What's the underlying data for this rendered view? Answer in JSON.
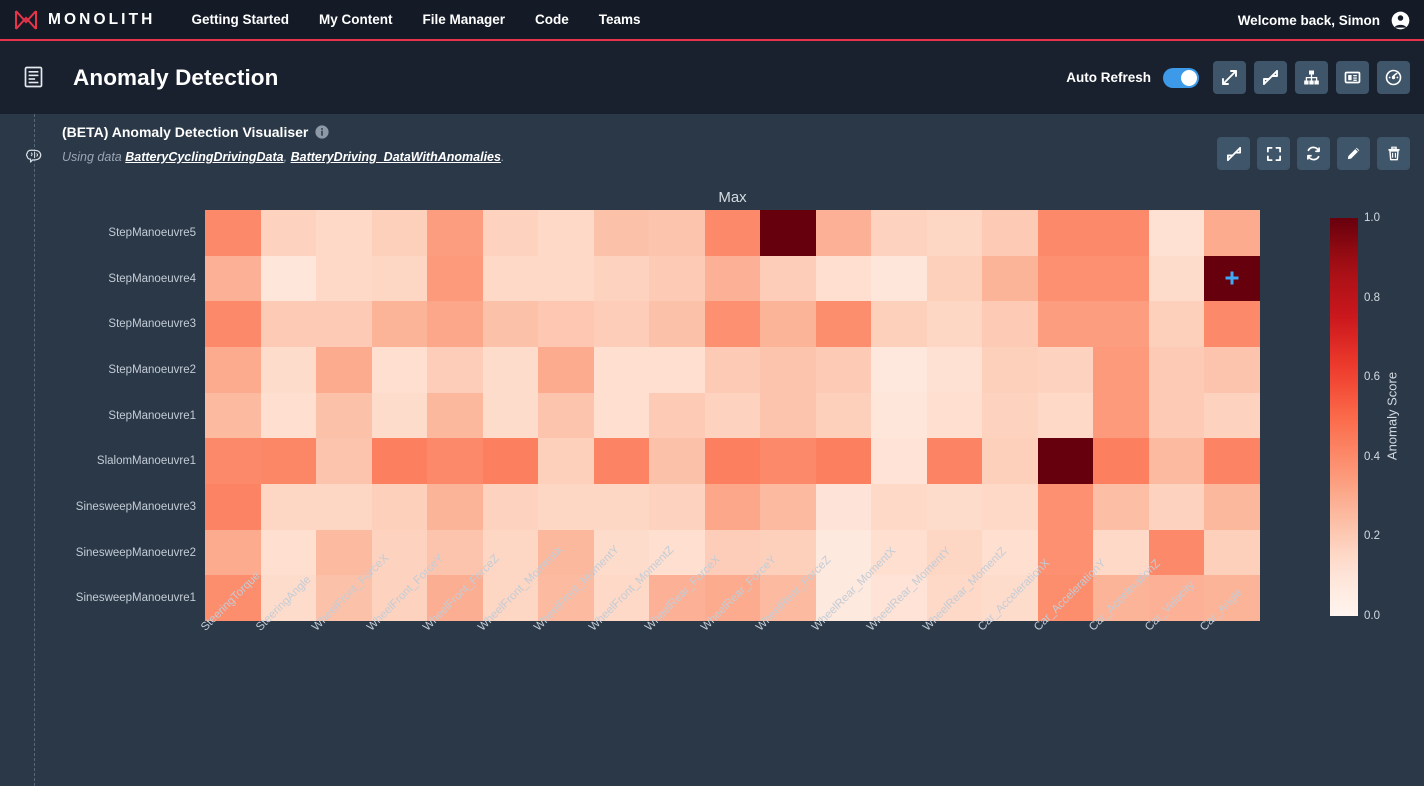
{
  "nav": {
    "brand": "MONOLITH",
    "brand_icon": "monolith-logo-icon",
    "links": [
      {
        "label": "Getting Started"
      },
      {
        "label": "My Content"
      },
      {
        "label": "File Manager"
      },
      {
        "label": "Code"
      },
      {
        "label": "Teams"
      }
    ],
    "welcome": "Welcome back, Simon",
    "account_icon": "account-circle-icon",
    "accent_color": "#e8334a"
  },
  "page_header": {
    "icon": "document-list-icon",
    "title": "Anomaly Detection",
    "auto_refresh_label": "Auto Refresh",
    "auto_refresh_on": true,
    "toggle_color": "#3d9ae8",
    "buttons": [
      {
        "name": "expand-icon",
        "label": "Expand"
      },
      {
        "name": "collapse-icon",
        "label": "Collapse"
      },
      {
        "name": "hierarchy-icon",
        "label": "Hierarchy"
      },
      {
        "name": "layout-panel-icon",
        "label": "Layout"
      },
      {
        "name": "dashboard-gauge-icon",
        "label": "Dashboard"
      }
    ]
  },
  "card": {
    "icon": "brain-icon",
    "title": "(BETA) Anomaly Detection Visualiser",
    "info_icon": "info-icon",
    "using_data_prefix": "Using data",
    "datasets": [
      {
        "label": "BatteryCyclingDrivingData"
      },
      {
        "label": "BatteryDriving_DataWithAnomalies"
      }
    ],
    "using_data_separator": ",",
    "using_data_suffix": ".",
    "actions": [
      {
        "name": "minimise-icon",
        "label": "Minimise"
      },
      {
        "name": "fullscreen-icon",
        "label": "Fullscreen"
      },
      {
        "name": "refresh-icon",
        "label": "Refresh"
      },
      {
        "name": "edit-pencil-icon",
        "label": "Edit"
      },
      {
        "name": "delete-trash-icon",
        "label": "Delete"
      }
    ]
  },
  "chart_data": {
    "type": "heatmap",
    "title": "Max",
    "xlabel": "",
    "ylabel": "",
    "colorbar_label": "Anomaly Score",
    "colormap": "Reds",
    "zlim": [
      0.0,
      1.0
    ],
    "colorbar_ticks": [
      "0.0",
      "0.2",
      "0.4",
      "0.6",
      "0.8",
      "1.0"
    ],
    "colorbar_tick_values": [
      0.0,
      0.2,
      0.4,
      0.6,
      0.8,
      1.0
    ],
    "grid": false,
    "legend_position": "right",
    "x_categories": [
      "SteeringTorque",
      "SteeringAngle",
      "WheelFront_ForceX",
      "WheelFront_ForceY",
      "WheelFront_ForceZ",
      "WheelFront_MomentX",
      "WheelFront_MomentY",
      "WheelFront_MomentZ",
      "WheelRear_ForceX",
      "WheelRear_ForceY",
      "WheelRear_ForceZ",
      "WheelRear_MomentX",
      "WheelRear_MomentY",
      "WheelRear_MomentZ",
      "Car_AccelerationX",
      "Car_AccelerationY",
      "Car_AccelerationZ",
      "Car_Velocity",
      "Car_Angle"
    ],
    "y_categories": [
      "StepManoeuvre5",
      "StepManoeuvre4",
      "StepManoeuvre3",
      "StepManoeuvre2",
      "StepManoeuvre1",
      "SlalomManoeuvre1",
      "SinesweepManoeuvre3",
      "SinesweepManoeuvre2",
      "SinesweepManoeuvre1"
    ],
    "values": [
      [
        0.4,
        0.17,
        0.15,
        0.18,
        0.34,
        0.17,
        0.15,
        0.23,
        0.22,
        0.4,
        1.0,
        0.28,
        0.17,
        0.16,
        0.2,
        0.4,
        0.4,
        0.12,
        0.3
      ],
      [
        0.28,
        0.09,
        0.15,
        0.16,
        0.35,
        0.15,
        0.15,
        0.17,
        0.2,
        0.28,
        0.19,
        0.13,
        0.09,
        0.18,
        0.27,
        0.38,
        0.38,
        0.14,
        1.0
      ],
      [
        0.4,
        0.2,
        0.2,
        0.27,
        0.31,
        0.23,
        0.21,
        0.19,
        0.23,
        0.38,
        0.27,
        0.39,
        0.18,
        0.16,
        0.2,
        0.34,
        0.34,
        0.18,
        0.4
      ],
      [
        0.3,
        0.14,
        0.3,
        0.13,
        0.19,
        0.14,
        0.3,
        0.13,
        0.13,
        0.2,
        0.22,
        0.2,
        0.08,
        0.12,
        0.18,
        0.17,
        0.35,
        0.2,
        0.22
      ],
      [
        0.25,
        0.13,
        0.23,
        0.14,
        0.26,
        0.14,
        0.22,
        0.13,
        0.2,
        0.17,
        0.22,
        0.18,
        0.09,
        0.13,
        0.17,
        0.15,
        0.35,
        0.2,
        0.17
      ],
      [
        0.4,
        0.41,
        0.22,
        0.43,
        0.4,
        0.43,
        0.18,
        0.42,
        0.23,
        0.43,
        0.4,
        0.43,
        0.11,
        0.42,
        0.18,
        1.0,
        0.43,
        0.25,
        0.42
      ],
      [
        0.42,
        0.16,
        0.16,
        0.18,
        0.27,
        0.17,
        0.16,
        0.16,
        0.17,
        0.31,
        0.25,
        0.1,
        0.15,
        0.14,
        0.15,
        0.38,
        0.24,
        0.17,
        0.26
      ],
      [
        0.3,
        0.13,
        0.25,
        0.17,
        0.22,
        0.16,
        0.26,
        0.14,
        0.13,
        0.19,
        0.18,
        0.07,
        0.13,
        0.16,
        0.13,
        0.38,
        0.15,
        0.4,
        0.18
      ],
      [
        0.39,
        0.14,
        0.23,
        0.17,
        0.29,
        0.16,
        0.25,
        0.15,
        0.28,
        0.3,
        0.25,
        0.07,
        0.11,
        0.15,
        0.14,
        0.39,
        0.27,
        0.28,
        0.27
      ]
    ],
    "cursor_marker": {
      "row": "StepManoeuvre4",
      "column": "Car_Angle",
      "row_index": 1,
      "column_index": 18,
      "color": "#3fa9f5",
      "icon": "crosshair-marker-icon"
    }
  }
}
